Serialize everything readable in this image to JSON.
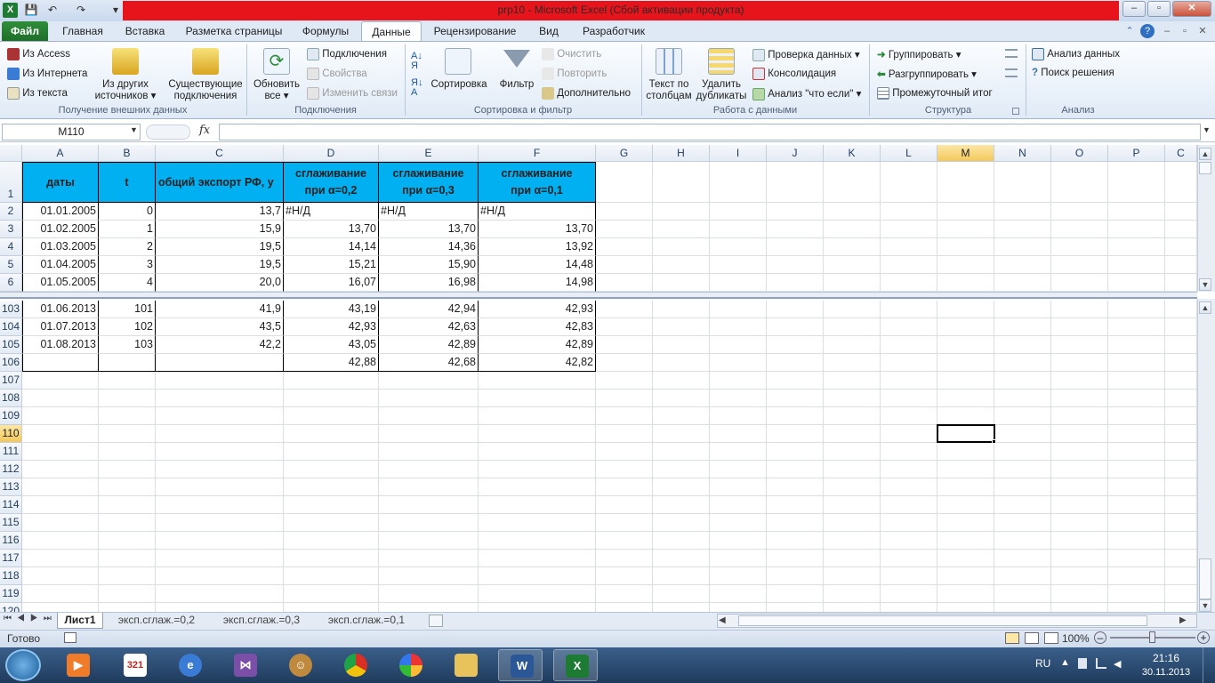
{
  "window": {
    "title": "prp10  -  Microsoft Excel (Сбой активации продукта)"
  },
  "qat": {
    "save": "💾",
    "undo": "↶",
    "redo": "↷",
    "customize": "▾"
  },
  "ribbon_tabs": [
    "Файл",
    "Главная",
    "Вставка",
    "Разметка страницы",
    "Формулы",
    "Данные",
    "Рецензирование",
    "Вид",
    "Разработчик"
  ],
  "groups": {
    "external": {
      "label": "Получение внешних данных",
      "from_access": "Из Access",
      "from_web": "Из Интернета",
      "from_text": "Из текста",
      "from_other_1": "Из других",
      "from_other_2": "источников ▾",
      "existing_1": "Существующие",
      "existing_2": "подключения"
    },
    "connections": {
      "label": "Подключения",
      "refresh_1": "Обновить",
      "refresh_2": "все ▾",
      "connections": "Подключения",
      "properties": "Свойства",
      "edit_links": "Изменить связи"
    },
    "sort_filter": {
      "label": "Сортировка и фильтр",
      "sort": "Сортировка",
      "filter": "Фильтр",
      "clear": "Очистить",
      "reapply": "Повторить",
      "advanced": "Дополнительно"
    },
    "data_tools": {
      "label": "Работа с данными",
      "text_to_cols_1": "Текст по",
      "text_to_cols_2": "столбцам",
      "remove_dup_1": "Удалить",
      "remove_dup_2": "дубликаты",
      "validation": "Проверка данных ▾",
      "consolidate": "Консолидация",
      "whatif": "Анализ \"что если\" ▾"
    },
    "outline": {
      "label": "Структура",
      "group": "Группировать ▾",
      "ungroup": "Разгруппировать ▾",
      "subtotal": "Промежуточный итог"
    },
    "analysis": {
      "label": "Анализ",
      "data_analysis": "Анализ данных",
      "solver": "Поиск решения"
    }
  },
  "formula_bar": {
    "name_box": "M110",
    "fx": "fx",
    "formula": ""
  },
  "columns": [
    "A",
    "B",
    "C",
    "D",
    "E",
    "F",
    "G",
    "H",
    "I",
    "J",
    "K",
    "L",
    "M",
    "N",
    "O",
    "P",
    "C"
  ],
  "selected": {
    "column": "M",
    "row": "110",
    "cell": "M110"
  },
  "table": {
    "headers": {
      "A": "даты",
      "B": "t",
      "C": "общий экспорт РФ, у",
      "D_1": "сглаживание",
      "D_2": "при α=0,2",
      "E_1": "сглаживание",
      "E_2": "при α=0,3",
      "F_1": "сглаживание",
      "F_2": "при α=0,1"
    },
    "top_rows": [
      {
        "row": "2",
        "A": "01.01.2005",
        "B": "0",
        "C": "13,7",
        "D": "#Н/Д",
        "E": "#Н/Д",
        "F": "#Н/Д"
      },
      {
        "row": "3",
        "A": "01.02.2005",
        "B": "1",
        "C": "15,9",
        "D": "13,70",
        "E": "13,70",
        "F": "13,70"
      },
      {
        "row": "4",
        "A": "01.03.2005",
        "B": "2",
        "C": "19,5",
        "D": "14,14",
        "E": "14,36",
        "F": "13,92"
      },
      {
        "row": "5",
        "A": "01.04.2005",
        "B": "3",
        "C": "19,5",
        "D": "15,21",
        "E": "15,90",
        "F": "14,48"
      },
      {
        "row": "6",
        "A": "01.05.2005",
        "B": "4",
        "C": "20,0",
        "D": "16,07",
        "E": "16,98",
        "F": "14,98"
      }
    ],
    "bottom_rows": [
      {
        "row": "103",
        "A": "01.06.2013",
        "B": "101",
        "C": "41,9",
        "D": "43,19",
        "E": "42,94",
        "F": "42,93"
      },
      {
        "row": "104",
        "A": "01.07.2013",
        "B": "102",
        "C": "43,5",
        "D": "42,93",
        "E": "42,63",
        "F": "42,83"
      },
      {
        "row": "105",
        "A": "01.08.2013",
        "B": "103",
        "C": "42,2",
        "D": "43,05",
        "E": "42,89",
        "F": "42,89"
      },
      {
        "row": "106",
        "A": "",
        "B": "",
        "C": "",
        "D": "42,88",
        "E": "42,68",
        "F": "42,82"
      }
    ],
    "empty_rows": [
      "107",
      "108",
      "109",
      "110",
      "111",
      "112",
      "113",
      "114",
      "115",
      "116",
      "117",
      "118",
      "119",
      "120"
    ]
  },
  "sheet_tabs": [
    "Лист1",
    "эксп.сглаж.=0,2",
    "эксп.сглаж.=0,3",
    "эксп.сглаж.=0,1"
  ],
  "status": {
    "ready": "Готово",
    "zoom": "100%"
  },
  "taskbar": {
    "lang": "RU",
    "time": "21:16",
    "date": "30.11.2013",
    "apps": [
      "media-player",
      "calendar-321",
      "ie-logo",
      "vs-logo",
      "game-bear",
      "chrome",
      "picasa",
      "explorer-folder",
      "word",
      "excel"
    ]
  }
}
